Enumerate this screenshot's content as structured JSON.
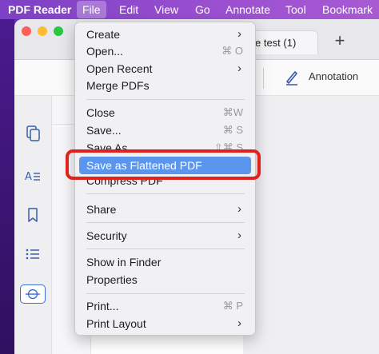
{
  "menubar": {
    "app_name": "PDF Reader",
    "items": [
      "File",
      "Edit",
      "View",
      "Go",
      "Annotate",
      "Tool",
      "Bookmark"
    ],
    "active": "File"
  },
  "window": {
    "tab_title": "e test (1)",
    "tab_add": "+",
    "toolbar": {
      "annotation_label": "Annotation"
    }
  },
  "file_menu": {
    "items": [
      {
        "label": "Create",
        "submenu": true
      },
      {
        "label": "Open...",
        "shortcut": "⌘ O"
      },
      {
        "label": "Open Recent",
        "submenu": true
      },
      {
        "label": "Merge PDFs"
      },
      {
        "label": "Close",
        "shortcut": "⌘W"
      },
      {
        "label": "Save...",
        "shortcut": "⌘ S"
      },
      {
        "label": "Save As",
        "shortcut": "⇧⌘ S"
      },
      {
        "label": "Save as Flattened PDF",
        "highlighted": true
      },
      {
        "label": "Compress PDF"
      },
      {
        "label": "Share",
        "submenu": true
      },
      {
        "label": "Security",
        "submenu": true
      },
      {
        "label": "Show in Finder"
      },
      {
        "label": "Properties"
      },
      {
        "label": "Print...",
        "shortcut": "⌘ P"
      },
      {
        "label": "Print Layout",
        "submenu": true
      }
    ],
    "submenu_glyph": "›"
  },
  "colors": {
    "highlight": "#5b96ee",
    "callout": "#e0211e",
    "menubar": "#9a4fd0"
  }
}
